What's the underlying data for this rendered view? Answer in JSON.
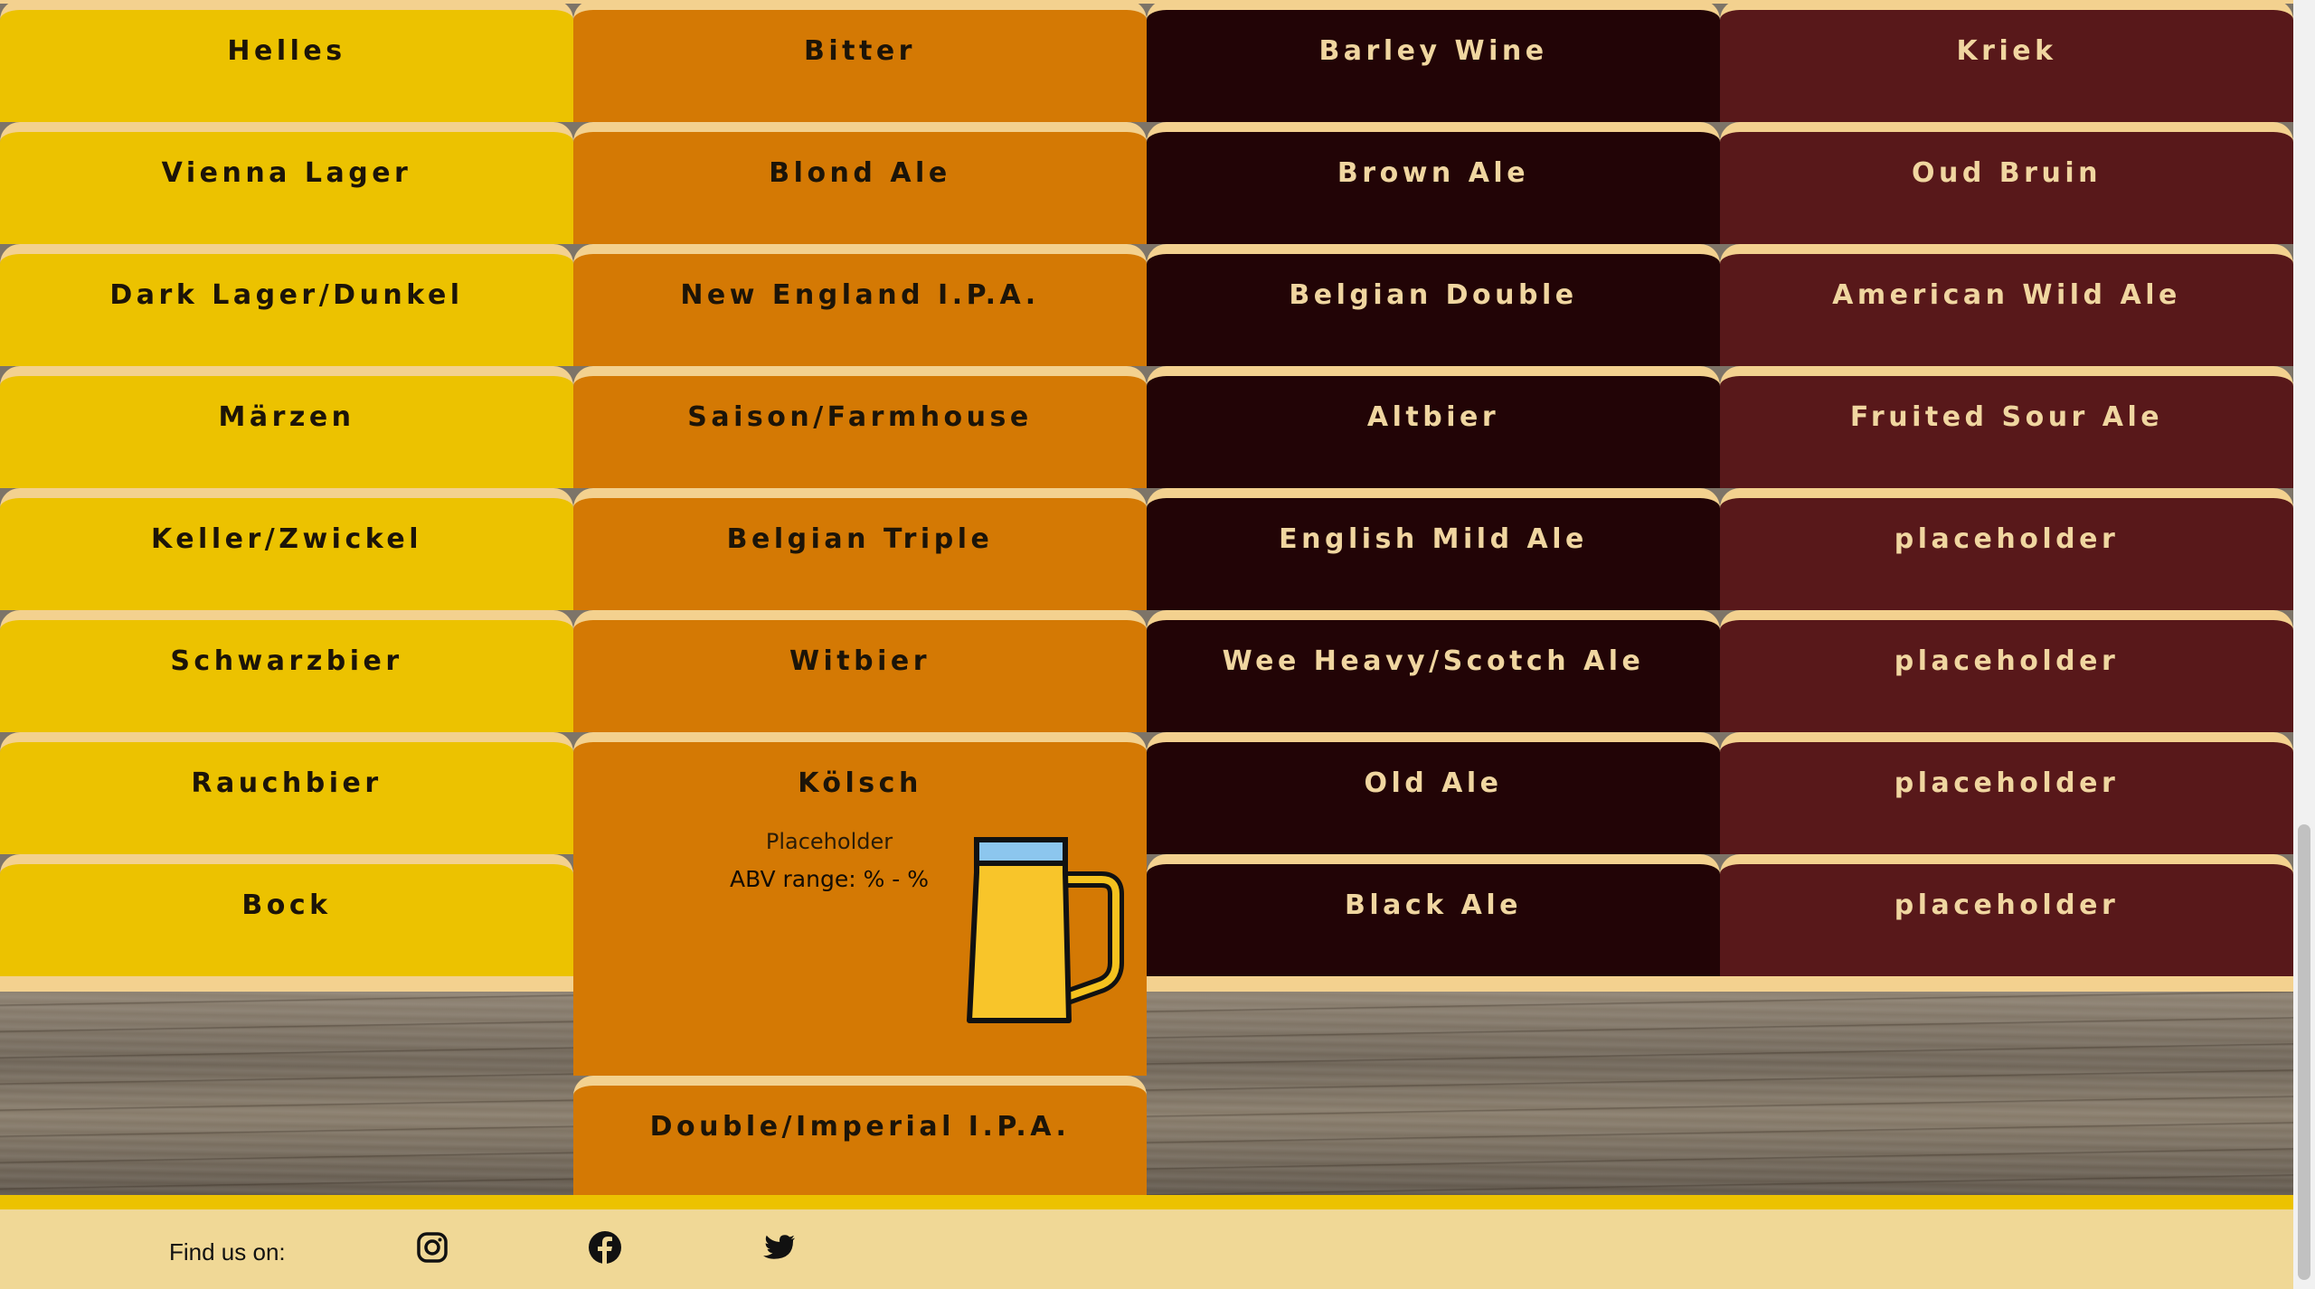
{
  "columns": [
    {
      "key": "pale",
      "color": "#ecc200",
      "items": [
        "Helles",
        "Vienna Lager",
        "Dark Lager/Dunkel",
        "Märzen",
        "Keller/Zwickel",
        "Schwarzbier",
        "Rauchbier",
        "Bock"
      ]
    },
    {
      "key": "amber",
      "color": "#d47904",
      "items": [
        "Bitter",
        "Blond Ale",
        "New England I.P.A.",
        "Saison/Farmhouse",
        "Belgian Triple",
        "Witbier",
        "Kölsch",
        "Double/Imperial I.P.A."
      ]
    },
    {
      "key": "dark",
      "color": "#220406",
      "items": [
        "Barley Wine",
        "Brown Ale",
        "Belgian Double",
        "Altbier",
        "English Mild Ale",
        "Wee Heavy/Scotch Ale",
        "Old Ale",
        "Black Ale"
      ]
    },
    {
      "key": "sour",
      "color": "#58181a",
      "items": [
        "Kriek",
        "Oud Bruin",
        "American Wild Ale",
        "Fruited Sour Ale",
        "placeholder",
        "placeholder",
        "placeholder",
        "placeholder"
      ]
    }
  ],
  "expanded": {
    "name": "Placeholder",
    "abv": "ABV range: % - %",
    "icon": "beer-mug-icon"
  },
  "footer": {
    "label": "Find us on:",
    "social": [
      "instagram-icon",
      "facebook-icon",
      "twitter-icon"
    ]
  },
  "colors": {
    "tile_border": "#f3d18f",
    "footer_bg": "#f0d896",
    "accent_yellow": "#ecc200"
  }
}
